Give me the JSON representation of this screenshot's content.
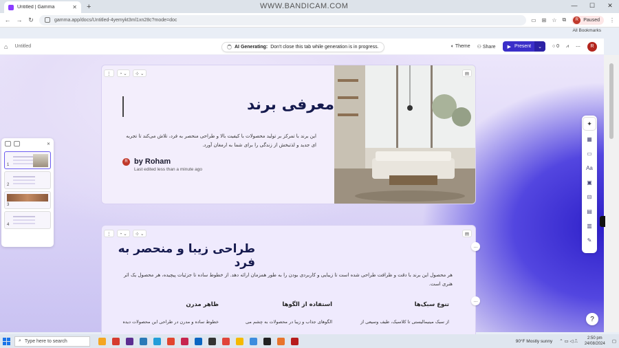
{
  "browser": {
    "tab_title": "Untitled | Gamma",
    "watermark": "WWW.BANDICAM.COM",
    "url": "gamma.app/docs/Untitled-4yemykt3ml1xn28c?mode=doc",
    "profile_status": "Paused",
    "profile_initial": "R",
    "bookmarks_label": "All Bookmarks"
  },
  "app": {
    "breadcrumb": "Untitled",
    "generating_bold": "AI Generating:",
    "generating_text": "Don't close this tab while generation is in progress.",
    "theme_label": "Theme",
    "share_label": "Share",
    "present_label": "Present",
    "comments_count": "0",
    "avatar_initial": "R"
  },
  "card1": {
    "title": "معرفی برند",
    "body": "این برند با تمرکز بر تولید محصولات با کیفیت بالا و طراحی منحصر به فرد، تلاش می‌کند تا تجربه ای جدید و لذتبخش از زندگی را برای شما به ارمغان آورد.",
    "author_initial": "R",
    "author": "by Roham",
    "edited": "Last edited less than a minute ago"
  },
  "card2": {
    "title": "طراحی زیبا و منحصر به فرد",
    "body": "هر محصول این برند با دقت و ظرافت طراحی شده است تا زیبایی و کاربردی بودن را به طور همزمان ارائه دهد. از خطوط ساده تا جزئیات پیچیده، هر محصول یک اثر هنری است.",
    "columns": [
      {
        "heading": "تنوع سبک‌ها",
        "text": "از سبک مینیمالیستی تا کلاسیک، طیف وسیعی از"
      },
      {
        "heading": "استفاده از الگوها",
        "text": "الگوهای جذاب و زیبا در محصولات به چشم می"
      },
      {
        "heading": "ظاهر مدرن",
        "text": "خطوط ساده و مدرن در طراحی این محصولات دیده"
      }
    ]
  },
  "outline": {
    "items": [
      "1",
      "2",
      "3",
      "4"
    ]
  },
  "taskbar": {
    "search_placeholder": "Type here to search",
    "weather": "90°F  Mostly sunny",
    "time": "2:50 pm",
    "date": "24/08/2024"
  },
  "colors": {
    "accent": "#3b2fc9",
    "title_text": "#151a4e",
    "avatar": "#c0392b"
  }
}
